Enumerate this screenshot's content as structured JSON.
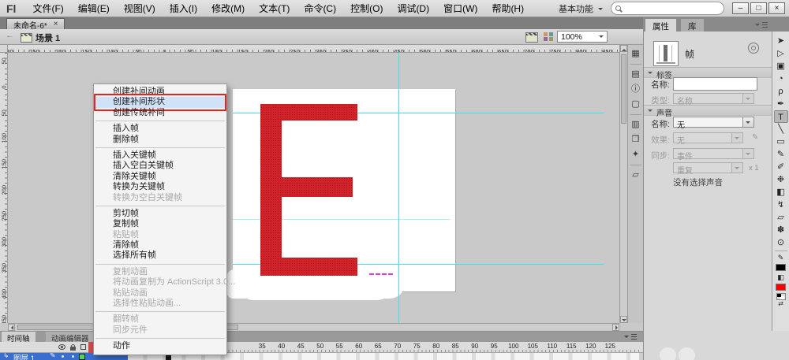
{
  "titlebar": {
    "logo": "Fl",
    "menus": [
      "文件(F)",
      "编辑(E)",
      "视图(V)",
      "插入(I)",
      "修改(M)",
      "文本(T)",
      "命令(C)",
      "控制(O)",
      "调试(D)",
      "窗口(W)",
      "帮助(H)"
    ],
    "workspace": "基本功能",
    "search_placeholder": "",
    "window": {
      "minimize": "–",
      "maximize": "□",
      "close": "×"
    }
  },
  "doc_tab": {
    "label": "未命名-6*",
    "close": "×"
  },
  "editbar": {
    "scene": "场景 1",
    "zoom": "100%"
  },
  "rulers": {
    "top": [
      "300",
      "250",
      "200",
      "150",
      "100",
      "50",
      "0",
      "50",
      "100",
      "150",
      "200",
      "250",
      "300",
      "350",
      "400",
      "450",
      "500",
      "550",
      "600",
      "650",
      "700",
      "750",
      "800",
      "850"
    ],
    "left": [
      "50",
      "0",
      "50",
      "100",
      "150",
      "200",
      "250",
      "300",
      "350",
      "400",
      "450"
    ]
  },
  "stage": {
    "letter": "E",
    "letter_color": "#d2232b",
    "guide_color": "#39e4ea"
  },
  "context_menu": {
    "items": [
      {
        "label": "创建补间动画",
        "state": "normal"
      },
      {
        "label": "创建补间形状",
        "state": "highlighted"
      },
      {
        "label": "创建传统补间",
        "state": "normal"
      },
      {
        "label": "",
        "state": "separator"
      },
      {
        "label": "插入帧",
        "state": "normal"
      },
      {
        "label": "删除帧",
        "state": "normal"
      },
      {
        "label": "",
        "state": "separator"
      },
      {
        "label": "插入关键帧",
        "state": "normal"
      },
      {
        "label": "插入空白关键帧",
        "state": "normal"
      },
      {
        "label": "清除关键帧",
        "state": "normal"
      },
      {
        "label": "转换为关键帧",
        "state": "normal"
      },
      {
        "label": "转换为空白关键帧",
        "state": "disabled"
      },
      {
        "label": "",
        "state": "separator"
      },
      {
        "label": "剪切帧",
        "state": "normal"
      },
      {
        "label": "复制帧",
        "state": "normal"
      },
      {
        "label": "粘贴帧",
        "state": "disabled"
      },
      {
        "label": "清除帧",
        "state": "normal"
      },
      {
        "label": "选择所有帧",
        "state": "normal"
      },
      {
        "label": "",
        "state": "separator"
      },
      {
        "label": "复制动画",
        "state": "disabled"
      },
      {
        "label": "将动画复制为 ActionScript 3.0...",
        "state": "disabled"
      },
      {
        "label": "粘贴动画",
        "state": "disabled"
      },
      {
        "label": "选择性粘贴动画...",
        "state": "disabled"
      },
      {
        "label": "",
        "state": "separator"
      },
      {
        "label": "翻转帧",
        "state": "disabled"
      },
      {
        "label": "同步元件",
        "state": "disabled"
      },
      {
        "label": "",
        "state": "separator"
      },
      {
        "label": "动作",
        "state": "normal"
      }
    ]
  },
  "properties": {
    "tabs": [
      "属性",
      "库"
    ],
    "object_type": "帧",
    "label_section": {
      "title": "标签",
      "name_label": "名称:",
      "name_value": "",
      "type_label": "类型:",
      "type_value": "名称"
    },
    "sound_section": {
      "title": "声音",
      "name_label": "名称:",
      "name_value": "无",
      "effect_label": "效果:",
      "effect_value": "无",
      "sync_label": "同步:",
      "sync_value": "事件",
      "repeat_value": "重复",
      "repeat_times": "x 1",
      "status": "没有选择声音"
    }
  },
  "dock_icons": [
    {
      "name": "align-panel-icon",
      "glyph": "▦",
      "state": "icon"
    },
    {
      "name": "dock-separator",
      "glyph": "",
      "state": "sep"
    },
    {
      "name": "scene-panel-icon",
      "glyph": "▤",
      "state": "icon"
    },
    {
      "name": "info-panel-icon",
      "glyph": "ⓘ",
      "state": "icon"
    },
    {
      "name": "transform-panel-icon",
      "glyph": "▢",
      "state": "icon"
    },
    {
      "name": "dock-separator",
      "glyph": "",
      "state": "sep"
    },
    {
      "name": "history-panel-icon",
      "glyph": "▥",
      "state": "icon"
    },
    {
      "name": "components-panel-icon",
      "glyph": "❒",
      "state": "icon"
    },
    {
      "name": "motion-presets-panel-icon",
      "glyph": "✦",
      "state": "icon"
    },
    {
      "name": "dock-separator",
      "glyph": "",
      "state": "sep"
    },
    {
      "name": "project-panel-icon",
      "glyph": "▱",
      "state": "icon"
    }
  ],
  "tools": [
    {
      "name": "selection-tool-icon",
      "glyph": "➤",
      "state": "normal"
    },
    {
      "name": "subselection-tool-icon",
      "glyph": "▷",
      "state": "normal"
    },
    {
      "name": "free-transform-tool-icon",
      "glyph": "▣",
      "state": "normal"
    },
    {
      "name": "3d-rotation-tool-icon",
      "glyph": "◔",
      "state": "normal"
    },
    {
      "name": "lasso-tool-icon",
      "glyph": "ρ",
      "state": "normal"
    },
    {
      "name": "pen-tool-icon",
      "glyph": "✒",
      "state": "normal"
    },
    {
      "name": "text-tool-icon",
      "glyph": "T",
      "state": "selected"
    },
    {
      "name": "line-tool-icon",
      "glyph": "╲",
      "state": "normal"
    },
    {
      "name": "rectangle-tool-icon",
      "glyph": "▭",
      "state": "normal"
    },
    {
      "name": "pencil-tool-icon",
      "glyph": "✎",
      "state": "normal"
    },
    {
      "name": "brush-tool-icon",
      "glyph": "✐",
      "state": "normal"
    },
    {
      "name": "deco-tool-icon",
      "glyph": "❉",
      "state": "normal"
    },
    {
      "name": "paint-bucket-tool-icon",
      "glyph": "◧",
      "state": "normal"
    },
    {
      "name": "eyedropper-tool-icon",
      "glyph": "↯",
      "state": "normal"
    },
    {
      "name": "eraser-tool-icon",
      "glyph": "▱",
      "state": "normal"
    },
    {
      "name": "hand-tool-icon",
      "glyph": "✽",
      "state": "normal"
    },
    {
      "name": "zoom-tool-icon",
      "glyph": "⊙",
      "state": "normal"
    },
    {
      "name": "tool-separator",
      "glyph": "",
      "state": "sep"
    }
  ],
  "timeline": {
    "tabs": [
      "时间轴",
      "动画编辑器"
    ],
    "layer": {
      "name": "图层 1"
    },
    "frame_numbers": [
      "35",
      "40",
      "45",
      "50",
      "55",
      "60",
      "65",
      "70",
      "75",
      "80",
      "85",
      "90",
      "95",
      "100",
      "105",
      "110",
      "115",
      "120",
      "125"
    ]
  },
  "icons": {
    "back_arrow": "←",
    "effect_edit_pencil": "✎",
    "layer_pencil": "✎",
    "layer_type": "↳",
    "stroke_pencil": "✎",
    "swap_colors": "⇄"
  },
  "colors": {
    "letter_red": "#d2232b",
    "guide_cyan": "#39e4ea",
    "annotation_red": "#e8231e",
    "menu_highlight_blue": "#cfe2f7",
    "layer_selected_blue": "#3a6fd0",
    "outline_chip_green": "#53d453",
    "fill_swatch": "#ff0000",
    "stroke_swatch": "#000000"
  }
}
